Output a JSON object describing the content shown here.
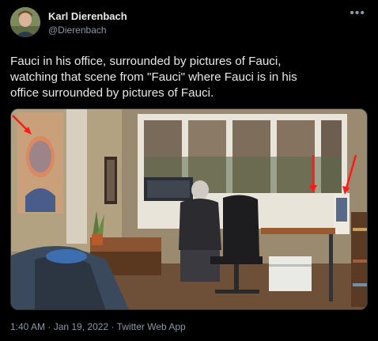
{
  "tweet": {
    "author": {
      "display_name": "Karl Dierenbach",
      "handle": "@Dierenbach",
      "avatar_icon": "person-avatar"
    },
    "more_icon": "more-options-icon",
    "text_lines": [
      "Fauci in his office, surrounded by pictures of Fauci,",
      "watching that scene from \"Fauci\" where Fauci is in his",
      "office surrounded by pictures of Fauci."
    ],
    "media": {
      "type": "photo",
      "arrow_color": "#ff1a1a"
    },
    "timestamp": "1:40 AM",
    "date": "Jan 19, 2022",
    "source": "Twitter Web App",
    "separator": " · "
  },
  "colors": {
    "background": "#000000",
    "text_primary": "#e7e9ea",
    "text_secondary": "#8b98a5",
    "border": "#2f3336"
  }
}
